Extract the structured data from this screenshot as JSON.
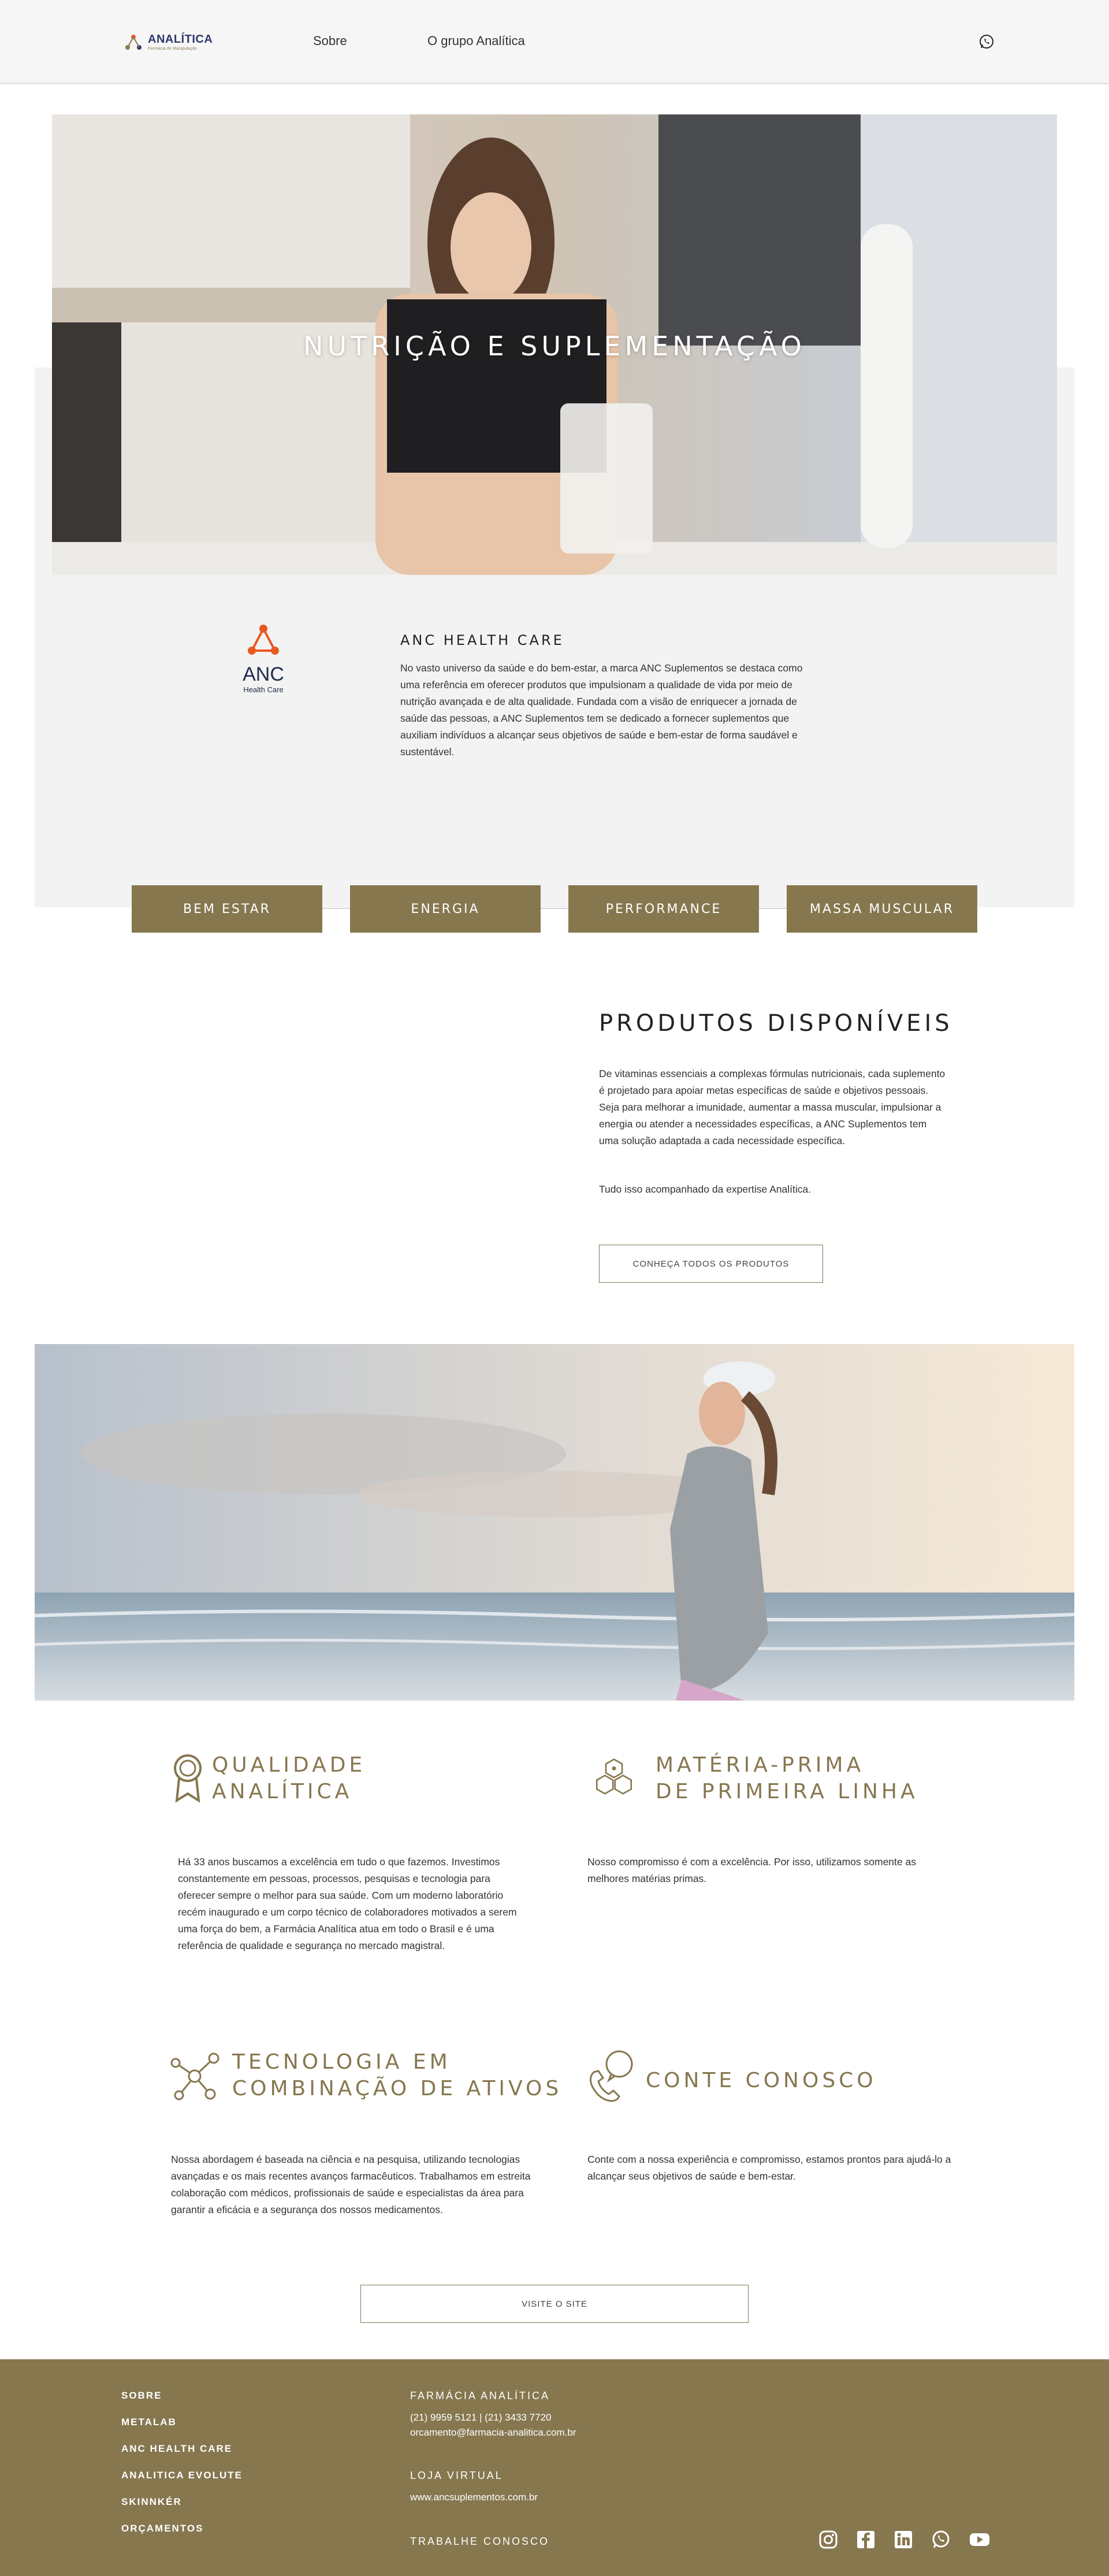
{
  "header": {
    "logo_text": "ANALÍTICA",
    "logo_sub": "Farmácia de Manipulação",
    "nav": [
      "Sobre",
      "O grupo Analítica"
    ],
    "whatsapp_icon": "whatsapp-icon"
  },
  "hero": {
    "title": "NUTRIÇÃO E SUPLEMENTAÇÃO"
  },
  "anc": {
    "logo_name": "ANC",
    "logo_sub": "Health Care",
    "title": "ANC HEALTH CARE",
    "text": "No vasto universo da saúde e do bem-estar, a marca ANC Suplementos se destaca como uma referência em oferecer produtos que impulsionam a qualidade de vida por meio de nutrição avançada e de alta qualidade. Fundada com a visão de enriquecer a jornada de saúde das pessoas, a ANC Suplementos tem se dedicado a fornecer suplementos que auxiliam indivíduos a alcançar seus objetivos de saúde e bem-estar de forma saudável e sustentável."
  },
  "categories": [
    "BEM ESTAR",
    "ENERGIA",
    "PERFORMANCE",
    "MASSA MUSCULAR"
  ],
  "produtos": {
    "title": "PRODUTOS DISPONÍVEIS",
    "text": "De vitaminas essenciais a complexas fórmulas nutricionais, cada suplemento é projetado para apoiar metas específicas de saúde e objetivos pessoais. Seja para melhorar a imunidade, aumentar a massa muscular, impulsionar a energia ou atender a necessidades específicas, a ANC Suplementos tem uma solução adaptada a cada necessidade específica.",
    "text2": "Tudo isso acompanhado da expertise Analítica.",
    "button": "CONHEÇA TODOS OS PRODUTOS"
  },
  "features": [
    {
      "icon": "award-ribbon-icon",
      "title_line1": "QUALIDADE",
      "title_line2": "ANALÍTICA",
      "text": "Há 33 anos buscamos a excelência em tudo o que fazemos. Investimos constantemente em pessoas, processos, pesquisas e tecnologia para oferecer sempre o melhor para sua saúde. Com um moderno laboratório recém inaugurado e um corpo técnico de colaboradores motivados a serem uma força do bem, a Farmácia Analítica atua em todo o Brasil e é uma referência de qualidade e segurança no mercado magistral."
    },
    {
      "icon": "molecule-icon",
      "title_line1": "MATÉRIA-PRIMA",
      "title_line2": "DE PRIMEIRA LINHA",
      "text": "Nosso compromisso é com a excelência. Por isso, utilizamos somente as melhores matérias primas."
    },
    {
      "icon": "network-nodes-icon",
      "title_line1": "TECNOLOGIA EM",
      "title_line2": "COMBINAÇÃO DE ATIVOS",
      "text": "Nossa abordagem é baseada na ciência e na pesquisa, utilizando tecnologias avançadas e os mais recentes avanços farmacêuticos. Trabalhamos em estreita colaboração com médicos, profissionais de saúde e especialistas da área para garantir a eficácia e a segurança dos nossos medicamentos."
    },
    {
      "icon": "phone-chat-icon",
      "title_line1": "CONTE CONOSCO",
      "title_line2": "",
      "text": "Conte com a nossa experiência e compromisso, estamos prontos para ajudá-lo a alcançar seus objetivos de saúde e bem-estar."
    }
  ],
  "site_button": "VISITE O SITE",
  "footer": {
    "links": [
      "SOBRE",
      "METALAB",
      "ANC HEALTH CARE",
      "ANALITICA EVOLUTE",
      "SKINNKÉR",
      "ORÇAMENTOS"
    ],
    "farmacia_title": "FARMÁCIA ANALÍTICA",
    "phones": "(21) 9959 5121 | (21) 3433 7720",
    "email": "orcamento@farmacia-analitica.com.br",
    "loja_title": "LOJA VIRTUAL",
    "loja_url": "www.ancsuplementos.com.br",
    "trabalhe": "TRABALHE CONOSCO",
    "social": [
      "instagram-icon",
      "facebook-icon",
      "linkedin-icon",
      "whatsapp-icon",
      "youtube-icon"
    ]
  },
  "colors": {
    "brand_gold": "#86774f",
    "band_grey": "#f3f3f3",
    "anc_orange": "#e8591f",
    "anc_navy": "#1f2a4d"
  }
}
